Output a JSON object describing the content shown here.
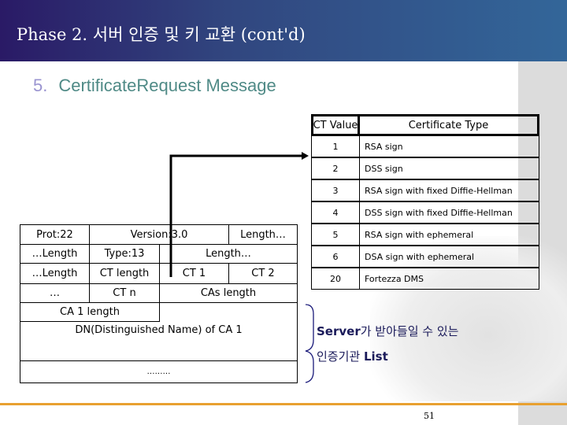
{
  "header": {
    "title": "Phase 2. 서버 인증 및 키 교환 (cont'd)"
  },
  "section": {
    "number": "5.",
    "title": "CertificateRequest Message"
  },
  "message_table": {
    "prot": "Prot:22",
    "version": "Version:3.0",
    "length1": "Length…",
    "length2": "…Length",
    "type": "Type:13",
    "length3": "Length…",
    "length4": "…Length",
    "ct_length": "CT length",
    "ct1": "CT 1",
    "ct2": "CT 2",
    "ellipsis": "…",
    "ctn": "CT n",
    "cas_length": "CAs length",
    "ca1_length": "CA 1 length",
    "dn": "DN(Distinguished Name) of CA 1",
    "more": "………"
  },
  "ct_table": {
    "headers": [
      "CT Value",
      "Certificate Type"
    ],
    "rows": [
      {
        "value": "1",
        "type": "RSA sign"
      },
      {
        "value": "2",
        "type": "DSS sign"
      },
      {
        "value": "3",
        "type": "RSA sign with fixed Diffie-Hellman"
      },
      {
        "value": "4",
        "type": "DSS sign with fixed Diffie-Hellman"
      },
      {
        "value": "5",
        "type": "RSA sign with ephemeral"
      },
      {
        "value": "6",
        "type": "DSA sign with ephemeral"
      },
      {
        "value": "20",
        "type": "Fortezza DMS"
      }
    ]
  },
  "note": {
    "line1_bold": "Server",
    "line1_rest": "가 받아들일 수 있는",
    "line2_rest": "인증기관 ",
    "line2_bold": "List"
  },
  "footer": {
    "page": "51"
  },
  "colors": {
    "header_start": "#2a1a66",
    "header_end": "#336699",
    "subtitle": "#4f8a86",
    "accent_line": "#e8a030",
    "brace": "#1a1a7a"
  }
}
